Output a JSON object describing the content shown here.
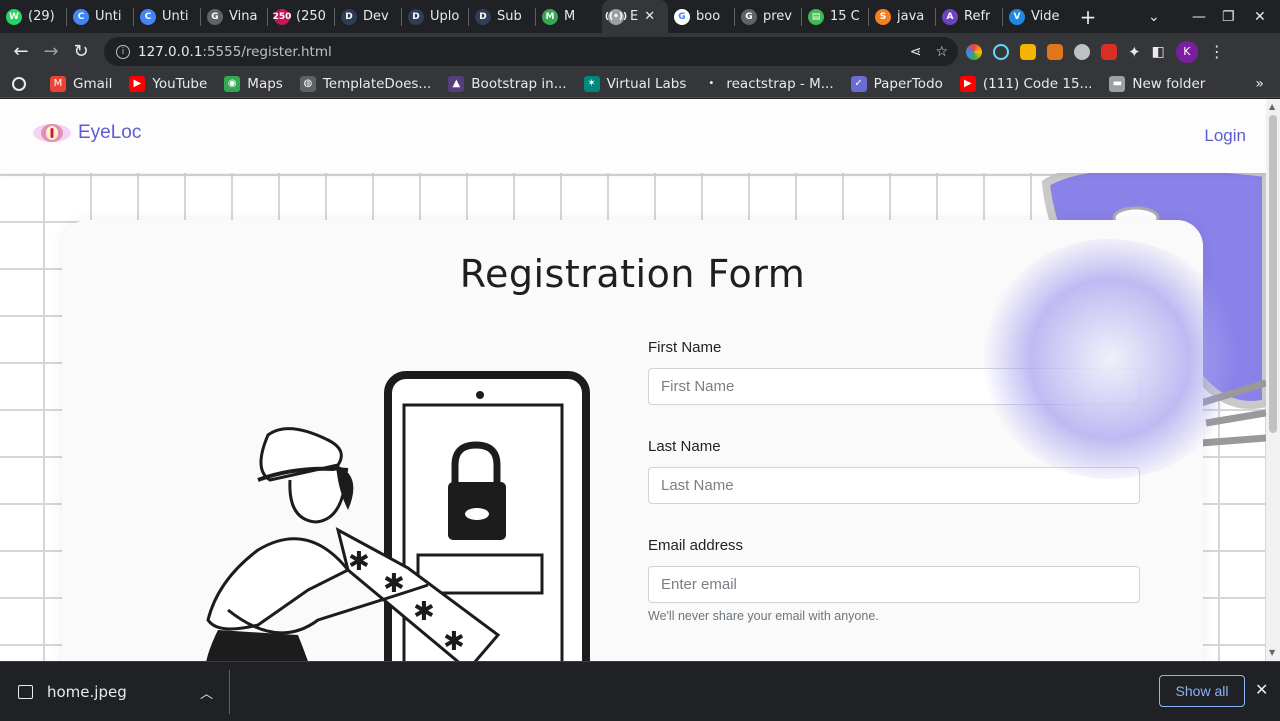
{
  "browser": {
    "tabs": [
      {
        "title": "(29)",
        "color": "#25d366",
        "glyph": "W"
      },
      {
        "title": "Unti",
        "color": "#4285f4",
        "glyph": "C"
      },
      {
        "title": "Unti",
        "color": "#4285f4",
        "glyph": "C"
      },
      {
        "title": "Vina",
        "color": "#5f6368",
        "glyph": "G"
      },
      {
        "title": "(250",
        "color": "#c2185b",
        "glyph": "250"
      },
      {
        "title": "Dev",
        "color": "#2f3d55",
        "glyph": "D"
      },
      {
        "title": "Uplo",
        "color": "#2f3d55",
        "glyph": "D"
      },
      {
        "title": "Sub",
        "color": "#2f3d55",
        "glyph": "D"
      },
      {
        "title": "M",
        "color": "#34a853",
        "glyph": "M"
      },
      {
        "title": "E",
        "color": "#9aa0a6",
        "glyph": "((•))",
        "active": true
      },
      {
        "title": "boo",
        "color": "#ffffff",
        "glyph": "G"
      },
      {
        "title": "prev",
        "color": "#5f6368",
        "glyph": "G"
      },
      {
        "title": "15 C",
        "color": "#3fb950",
        "glyph": "▤"
      },
      {
        "title": "java",
        "color": "#f48024",
        "glyph": "S"
      },
      {
        "title": "Refr",
        "color": "#6f42c1",
        "glyph": "A"
      },
      {
        "title": "Vide",
        "color": "#1e88e5",
        "glyph": "V"
      }
    ],
    "url_host": "127.0.0.1",
    "url_rest": ":5555/register.html",
    "profile_initial": "K",
    "bookmarks": [
      {
        "label": "Gmail",
        "color": "#ea4335",
        "glyph": "M"
      },
      {
        "label": "YouTube",
        "color": "#ff0000",
        "glyph": "▶"
      },
      {
        "label": "Maps",
        "color": "#34a853",
        "glyph": "◉"
      },
      {
        "label": "TemplateDoes...",
        "color": "#5f6368",
        "glyph": "◍"
      },
      {
        "label": "Bootstrap in...",
        "color": "#563d7c",
        "glyph": "▲"
      },
      {
        "label": "Virtual Labs",
        "color": "#00897b",
        "glyph": "✶"
      },
      {
        "label": "reactstrap - M...",
        "color": "#35363a",
        "glyph": "•"
      },
      {
        "label": "PaperTodo",
        "color": "#6b6bd6",
        "glyph": "✓"
      },
      {
        "label": "(111) Code 15...",
        "color": "#ff0000",
        "glyph": "▶"
      },
      {
        "label": "New folder",
        "color": "#9aa0a6",
        "glyph": "▬"
      }
    ]
  },
  "page": {
    "brand": "EyeLoc",
    "login": "Login",
    "form_title": "Registration Form",
    "fields": [
      {
        "label": "First Name",
        "placeholder": "First Name"
      },
      {
        "label": "Last Name",
        "placeholder": "Last Name"
      },
      {
        "label": "Email address",
        "placeholder": "Enter email",
        "help": "We'll never share your email with anyone."
      }
    ]
  },
  "downloads": {
    "file": "home.jpeg",
    "show_all": "Show all"
  }
}
